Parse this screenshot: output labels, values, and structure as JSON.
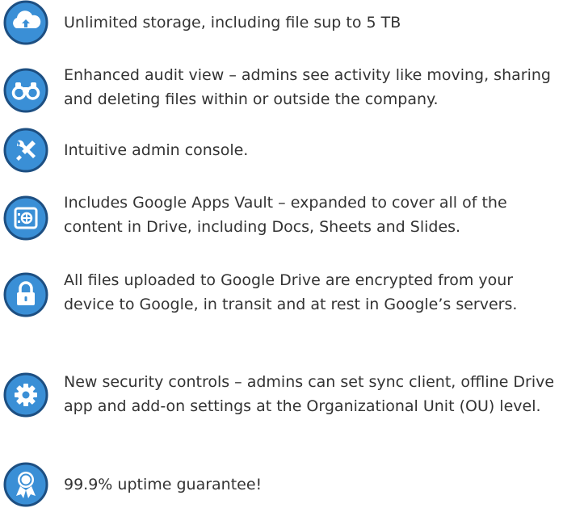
{
  "colors": {
    "icon_fill": "#3a8fd6",
    "icon_ring": "#1d4f82",
    "icon_glyph": "#ffffff",
    "text": "#333333"
  },
  "features": [
    {
      "icon": "cloud-upload-icon",
      "text": "Unlimited storage, including file sup to 5 TB"
    },
    {
      "icon": "binoculars-icon",
      "text": "Enhanced audit view – admins see activity like moving, sharing and deleting files within or outside the company."
    },
    {
      "icon": "tools-icon",
      "text": "Intuitive admin console."
    },
    {
      "icon": "vault-icon",
      "text": "Includes Google Apps Vault – expanded to cover all of the content in Drive, including Docs, Sheets and Slides."
    },
    {
      "icon": "lock-icon",
      "text": "All files uploaded to Google Drive are encrypted from your device to Google, in transit and at rest in Google’s servers."
    },
    {
      "icon": "gear-icon",
      "text": "New security controls – admins can set sync client, offline Drive app and add-on settings at the Organizational Unit (OU) level."
    },
    {
      "icon": "award-ribbon-icon",
      "text": "99.9% uptime guarantee!"
    }
  ]
}
